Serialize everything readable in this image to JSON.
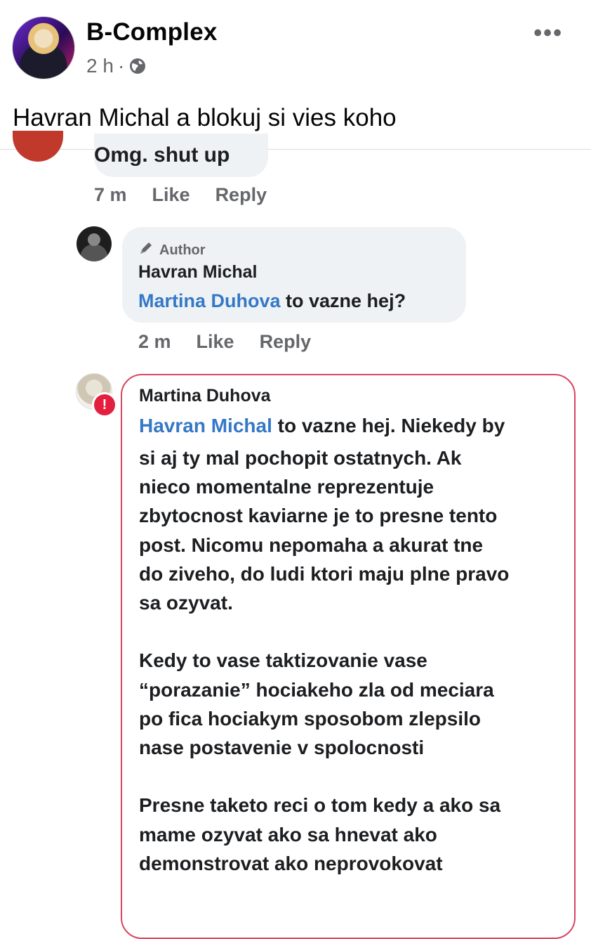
{
  "post": {
    "page_name": "B-Complex",
    "time": "2 h",
    "separator": "·",
    "caption": "Havran Michal a blokuj si vies koho"
  },
  "comments": [
    {
      "text": "Omg. shut up",
      "time": "7 m",
      "like": "Like",
      "reply": "Reply"
    },
    {
      "badge": "Author",
      "author": "Havran Michal",
      "mention": "Martina Duhova",
      "text": " to vazne hej?",
      "time": "2 m",
      "like": "Like",
      "reply": "Reply"
    },
    {
      "author": "Martina Duhova",
      "mention": "Havran Michal",
      "first_line_rest": " to vazne hej. Niekedy by",
      "body": "si aj ty mal pochopit ostatnych. Ak\nnieco momentalne reprezentuje\nzbytocnost kaviarne je to presne tento\npost. Nicomu nepomaha a akurat tne\ndo ziveho, do ludi ktori maju plne pravo\nsa ozyvat.\n\nKedy to vase taktizovanie vase\n“porazanie” hociakeho zla od meciara\npo fica hociakym sposobom zlepsilo\nnase postavenie v spolocnosti\n\nPresne taketo reci o tom kedy a ako sa\nmame ozyvat ako sa hnevat ako\ndemonstrovat ako neprovokovat"
    }
  ],
  "icons": {
    "globe": "globe-icon",
    "more": "more-options-icon",
    "author_badge": "pen-icon",
    "alert": "alert-icon"
  },
  "colors": {
    "mention": "#3578c7",
    "alert": "#e41e3f",
    "bubble": "#eff2f5",
    "highlight_border": "#d9455f"
  }
}
